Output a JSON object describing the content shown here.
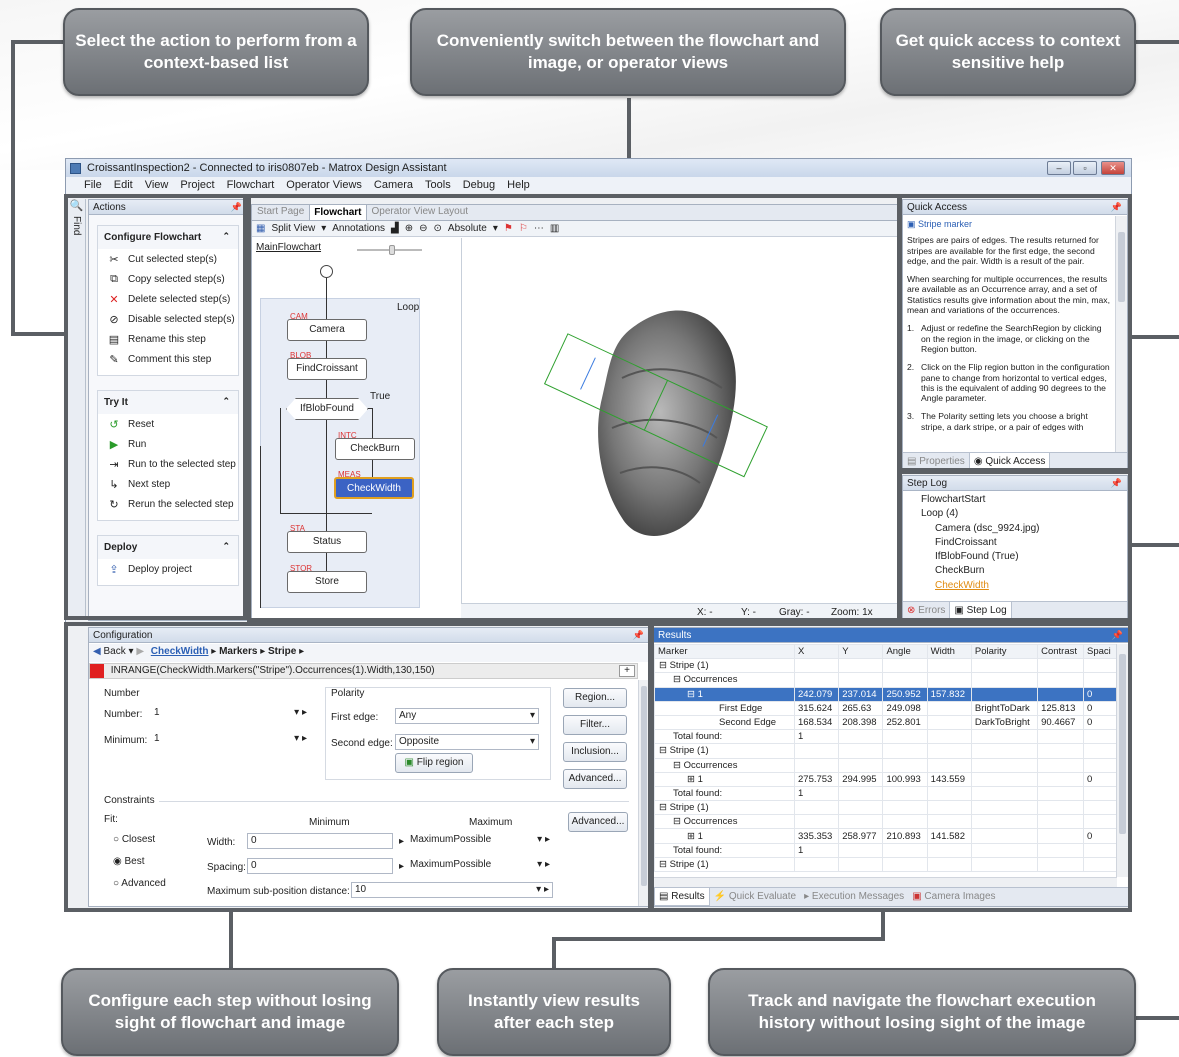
{
  "callouts": {
    "select_action": "Select the action to perform from a context-based list",
    "switch_views": "Conveniently switch between the flowchart and image, or operator views",
    "help": "Get quick access to context sensitive help",
    "configure": "Configure each step without losing sight of flowchart and image",
    "results": "Instantly view results after each step",
    "history": "Track and navigate the flowchart execution history without losing sight of the image"
  },
  "window": {
    "title": "CroissantInspection2 - Connected to iris0807eb - Matrox Design Assistant"
  },
  "menu": [
    "File",
    "Edit",
    "View",
    "Project",
    "Flowchart",
    "Operator Views",
    "Camera",
    "Tools",
    "Debug",
    "Help"
  ],
  "find_label": "Find",
  "actions": {
    "title": "Actions",
    "groups": [
      {
        "title": "Configure Flowchart",
        "items": [
          "Cut selected step(s)",
          "Copy selected step(s)",
          "Delete selected step(s)",
          "Disable selected step(s)",
          "Rename this step",
          "Comment this step"
        ]
      },
      {
        "title": "Try It",
        "items": [
          "Reset",
          "Run",
          "Run to the selected step",
          "Next step",
          "Rerun the selected step"
        ]
      },
      {
        "title": "Deploy",
        "items": [
          "Deploy project"
        ]
      }
    ]
  },
  "center": {
    "tabs": [
      "Start Page",
      "Flowchart",
      "Operator View Layout"
    ],
    "toolbar": {
      "split": "Split View",
      "annotations": "Annotations",
      "absolute": "Absolute"
    },
    "main_flowchart": "MainFlowchart",
    "loop": "Loop",
    "true_label": "True",
    "nodes": {
      "camera": "Camera",
      "find": "FindCroissant",
      "if": "IfBlobFound",
      "burn": "CheckBurn",
      "width": "CheckWidth",
      "status": "Status",
      "store": "Store"
    },
    "tags": {
      "cam": "CAM",
      "blob": "BLOB",
      "intc": "INTC",
      "meas": "MEAS",
      "sta": "STA",
      "stor": "STOR"
    },
    "status": {
      "x": "X: -",
      "y": "Y: -",
      "gray": "Gray: -",
      "zoom": "Zoom: 1x"
    }
  },
  "quick_access": {
    "title": "Quick Access",
    "heading": "Stripe marker",
    "p1": "Stripes are pairs of edges. The results returned for stripes are available for the first edge, the second edge, and the pair. Width is a result of the pair.",
    "p2": "When searching for multiple occurrences, the results are available as an Occurrence array, and a set of Statistics results give information about the min, max, mean and variations of the occurrences.",
    "li1": "Adjust or redefine the SearchRegion by clicking on the region in the image, or clicking on the Region button.",
    "li2": "Click on the Flip region button in the configuration pane to change from horizontal to vertical edges, this is the equivalent of adding 90 degrees to the Angle parameter.",
    "li3": "The Polarity setting lets you choose a bright stripe, a dark stripe, or a pair of edges with",
    "tabs": [
      "Properties",
      "Quick Access"
    ]
  },
  "step_log": {
    "title": "Step Log",
    "items": [
      "FlowchartStart",
      "Loop (4)",
      "Camera (dsc_9924.jpg)",
      "FindCroissant",
      "IfBlobFound (True)",
      "CheckBurn",
      "CheckWidth"
    ],
    "tabs": [
      "Errors",
      "Step Log"
    ]
  },
  "config": {
    "title": "Configuration",
    "nav": {
      "back": "Back",
      "step": "CheckWidth",
      "markers": "Markers",
      "stripe": "Stripe"
    },
    "expr": "INRANGE(CheckWidth.Markers(\"Stripe\").Occurrences(1).Width,130,150)",
    "number_group": "Number",
    "number_label": "Number:",
    "number_val": "1",
    "minimum_label": "Minimum:",
    "minimum_val": "1",
    "polarity_group": "Polarity",
    "first_edge": "First edge:",
    "first_val": "Any",
    "second_edge": "Second edge:",
    "second_val": "Opposite",
    "flip": "Flip region",
    "buttons": [
      "Region...",
      "Filter...",
      "Inclusion...",
      "Advanced..."
    ],
    "constraints": "Constraints",
    "fit": "Fit:",
    "min_h": "Minimum",
    "max_h": "Maximum",
    "fits": [
      "Closest",
      "Best",
      "Advanced"
    ],
    "width_label": "Width:",
    "width_min": "0",
    "width_max": "MaximumPossible",
    "spacing_label": "Spacing:",
    "spacing_min": "0",
    "spacing_max": "MaximumPossible",
    "maxsub_label": "Maximum sub-position distance:",
    "maxsub_val": "10",
    "adv2": "Advanced..."
  },
  "results": {
    "title": "Results",
    "columns": [
      "Marker",
      "X",
      "Y",
      "Angle",
      "Width",
      "Polarity",
      "Contrast",
      "Spaci"
    ],
    "rows": [
      [
        "⊟ Stripe (1)",
        "",
        "",
        "",
        "",
        "",
        "",
        ""
      ],
      [
        "⊟ Occurrences",
        "",
        "",
        "",
        "",
        "",
        "",
        ""
      ],
      [
        "⊟ 1",
        "242.079",
        "237.014",
        "250.952",
        "157.832",
        "",
        "",
        "0"
      ],
      [
        "First Edge",
        "315.624",
        "265.63",
        "249.098",
        "",
        "BrightToDark",
        "125.813",
        "0"
      ],
      [
        "Second Edge",
        "168.534",
        "208.398",
        "252.801",
        "",
        "DarkToBright",
        "90.4667",
        "0"
      ],
      [
        "Total found:",
        "1",
        "",
        "",
        "",
        "",
        "",
        ""
      ],
      [
        "⊟ Stripe (1)",
        "",
        "",
        "",
        "",
        "",
        "",
        ""
      ],
      [
        "⊟ Occurrences",
        "",
        "",
        "",
        "",
        "",
        "",
        ""
      ],
      [
        "⊞ 1",
        "275.753",
        "294.995",
        "100.993",
        "143.559",
        "",
        "",
        "0"
      ],
      [
        "Total found:",
        "1",
        "",
        "",
        "",
        "",
        "",
        ""
      ],
      [
        "⊟ Stripe (1)",
        "",
        "",
        "",
        "",
        "",
        "",
        ""
      ],
      [
        "⊟ Occurrences",
        "",
        "",
        "",
        "",
        "",
        "",
        ""
      ],
      [
        "⊞ 1",
        "335.353",
        "258.977",
        "210.893",
        "141.582",
        "",
        "",
        "0"
      ],
      [
        "Total found:",
        "1",
        "",
        "",
        "",
        "",
        "",
        ""
      ],
      [
        "⊟ Stripe (1)",
        "",
        "",
        "",
        "",
        "",
        "",
        ""
      ]
    ],
    "tabs": [
      "Results",
      "Quick Evaluate",
      "Execution Messages",
      "Camera Images"
    ]
  }
}
